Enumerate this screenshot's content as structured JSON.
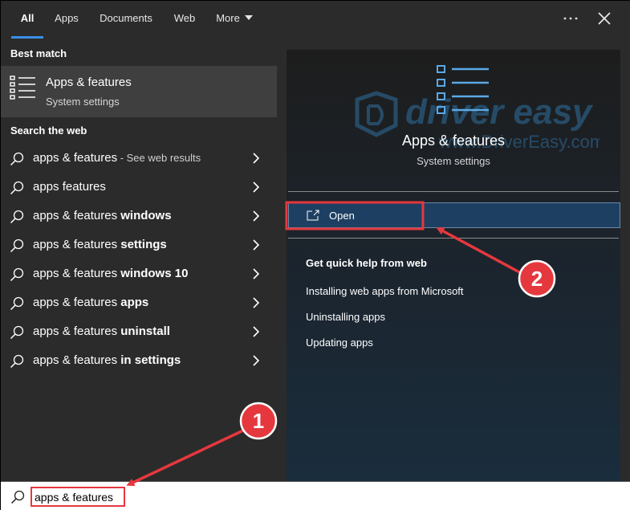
{
  "tabs": [
    {
      "label": "All",
      "active": true
    },
    {
      "label": "Apps"
    },
    {
      "label": "Documents"
    },
    {
      "label": "Web"
    },
    {
      "label": "More"
    }
  ],
  "toolbar": {
    "more_options_icon": "ellipsis-icon",
    "close_icon": "close-icon"
  },
  "left": {
    "best_match_heading": "Best match",
    "best_match": {
      "title": "Apps & features",
      "subtitle": "System settings",
      "icon": "apps-features-list-icon"
    },
    "search_web_heading": "Search the web",
    "web_results": [
      {
        "prefix": "apps & features",
        "bold": "",
        "suffix": " - See web results"
      },
      {
        "prefix": "apps features",
        "bold": "",
        "suffix": ""
      },
      {
        "prefix": "apps & features ",
        "bold": "windows",
        "suffix": ""
      },
      {
        "prefix": "apps & features ",
        "bold": "settings",
        "suffix": ""
      },
      {
        "prefix": "apps & features ",
        "bold": "windows 10",
        "suffix": ""
      },
      {
        "prefix": "apps & features ",
        "bold": "apps",
        "suffix": ""
      },
      {
        "prefix": "apps & features ",
        "bold": "uninstall",
        "suffix": ""
      },
      {
        "prefix": "apps & features ",
        "bold": "in settings",
        "suffix": ""
      }
    ]
  },
  "right": {
    "title": "Apps & features",
    "subtitle": "System settings",
    "open_label": "Open",
    "help_heading": "Get quick help from web",
    "help_links": [
      "Installing web apps from Microsoft",
      "Uninstalling apps",
      "Updating apps"
    ],
    "watermark_text": "driver easy",
    "watermark_url": "www.DriverEasy.com"
  },
  "search": {
    "value": "apps & features"
  },
  "annotations": [
    {
      "label": "1"
    },
    {
      "label": "2"
    }
  ],
  "colors": {
    "accent": "#3a8ee6",
    "open_bg": "#1d4062",
    "highlight": "#e5383e",
    "icon_blue": "#5aa9e6"
  }
}
